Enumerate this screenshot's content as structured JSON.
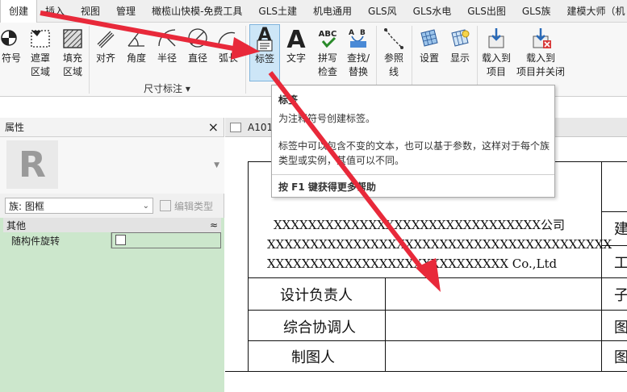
{
  "menubar": {
    "tabs": [
      "创建",
      "插入",
      "视图",
      "管理",
      "橄榄山快模-免费工具",
      "GLS土建",
      "机电通用",
      "GLS风",
      "GLS水电",
      "GLS出图",
      "GLS族",
      "建模大师（机"
    ],
    "active": "创建"
  },
  "ribbon": {
    "buttons": {
      "symbol": "符号",
      "mask": "遮罩\n区域",
      "fill": "填充\n区域",
      "align": "对齐",
      "angle": "角度",
      "radius": "半径",
      "diameter": "直径",
      "arc": "弧长",
      "label": "标签",
      "text": "文字",
      "spell": "拼写\n检查",
      "find": "查找/\n替换",
      "ref_line": "参照\n线",
      "settings": "设置",
      "display": "显示",
      "load": "载入到\n项目",
      "load_close": "载入到\n项目并关闭"
    },
    "group_dimension": "尺寸标注 ▾",
    "icon_glyphs": {
      "label": "A",
      "text": "A",
      "spell": "ABC"
    }
  },
  "tooltip": {
    "title": "标签",
    "desc": "为注释符号创建标签。",
    "body": "标签中可以包含不变的文本，也可以基于参数，这样对于每个族类型或实例，其值可以不同。",
    "help": "按 F1 键获得更多帮助"
  },
  "properties": {
    "title": "属性",
    "close": "×",
    "logo": "R",
    "family_value": "族: 图框",
    "edit_type": "编辑类型",
    "section": "其他",
    "section_toggle": "≈",
    "rows": [
      {
        "name": "随构件旋转",
        "checked": false
      }
    ]
  },
  "view": {
    "tab_label": "A101"
  },
  "titleblock": {
    "company_cn": "XXXXXXXXXXXXXXXXXXXXXXXXXXXXXXX公司",
    "company_x": "XXXXXXXXXXXXXXXXXXXXXXXXXXXXXXXXXXXXXXXX",
    "company_en": "XXXXXXXXXXXXXXXXXXXXXXXXXXXX Co.,Ltd",
    "rows": [
      "设计负责人",
      "综合协调人",
      "制图人"
    ],
    "right_cells": [
      "建",
      "工",
      "子",
      "图",
      "图"
    ]
  },
  "colors": {
    "accent": "#e8293a",
    "ribbon_active": "#cde6f7",
    "props_grid": "#cce7cc"
  }
}
